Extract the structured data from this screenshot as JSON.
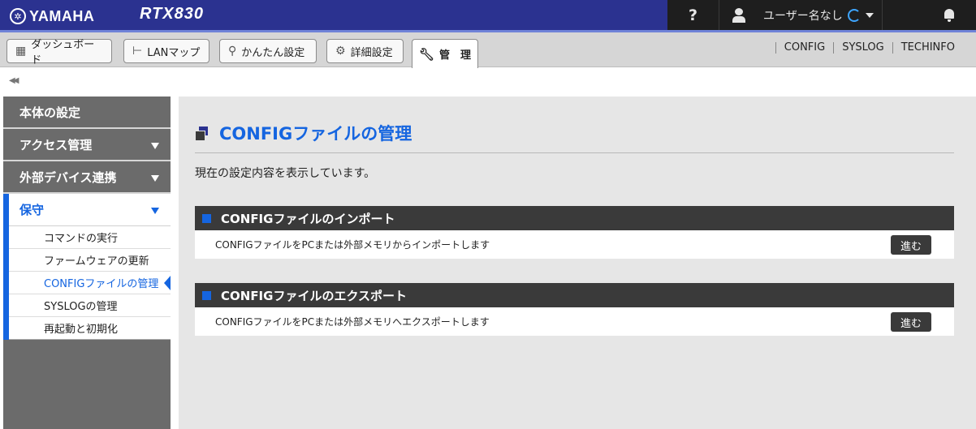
{
  "header": {
    "brand": "YAMAHA",
    "model": "RTX830",
    "help": "?",
    "user_label": "ユーザー名なし"
  },
  "tabs": [
    {
      "label": "ダッシュボード",
      "icon": "dashboard-icon"
    },
    {
      "label": "LANマップ",
      "icon": "lan-map-icon"
    },
    {
      "label": "かんたん設定",
      "icon": "wand-icon"
    },
    {
      "label": "詳細設定",
      "icon": "gear-icon"
    }
  ],
  "active_tab": {
    "label": "管　理",
    "icon": "wrench-icon"
  },
  "top_links": [
    "CONFIG",
    "SYSLOG",
    "TECHINFO"
  ],
  "sidebar": {
    "items": [
      "本体の設定",
      "アクセス管理",
      "外部デバイス連携"
    ],
    "open_section": "保守",
    "sub_items": [
      "コマンドの実行",
      "ファームウェアの更新",
      "CONFIGファイルの管理",
      "SYSLOGの管理",
      "再起動と初期化"
    ],
    "selected_sub": 2
  },
  "main": {
    "title": "CONFIGファイルの管理",
    "description": "現在の設定内容を表示しています。",
    "sections": [
      {
        "heading": "CONFIGファイルのインポート",
        "text": "CONFIGファイルをPCまたは外部メモリからインポートします",
        "button": "進む"
      },
      {
        "heading": "CONFIGファイルのエクスポート",
        "text": "CONFIGファイルをPCまたは外部メモリへエクスポートします",
        "button": "進む"
      }
    ]
  },
  "colors": {
    "header_bg": "#2b3290",
    "accent_blue": "#1565e0",
    "dark_bar": "#3a3a3a",
    "sidebar_bg": "#6b6b6b"
  }
}
